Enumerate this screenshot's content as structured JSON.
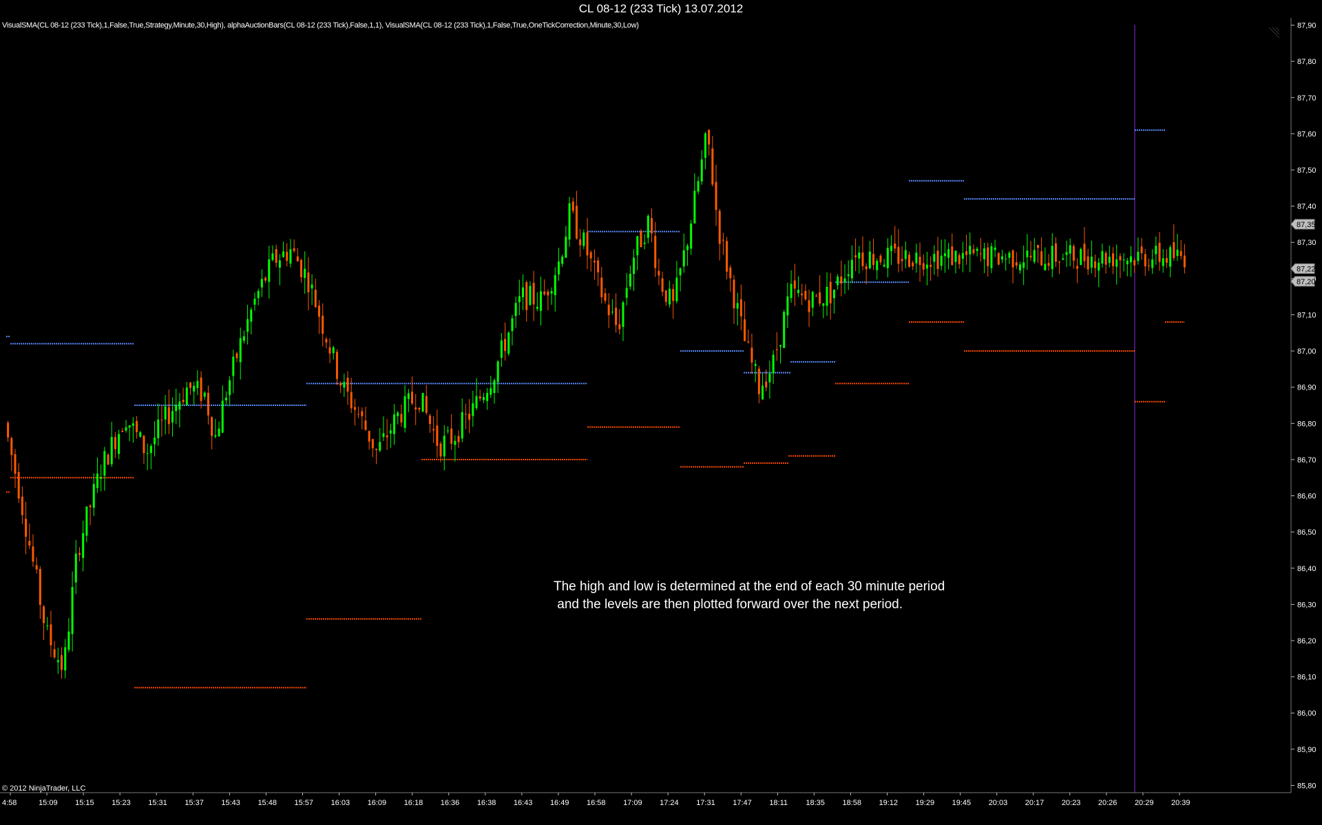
{
  "window": {
    "title": "CL 08-12 (233 Tick)  13.07.2012"
  },
  "indicator_legend": "VisualSMA(CL 08-12 (233 Tick),1,False,True,Strategy,Minute,30,High), alphaAuctionBars(CL 08-12 (233 Tick),False,1,1), VisualSMA(CL 08-12 (233 Tick),1,False,True,OneTickCorrection,Minute,30,Low)",
  "annotation": "The high and low is determined at the end of each 30 minute period\n and the levels are then plotted forward over the next period.",
  "copyright": "© 2012 NinjaTrader, LLC",
  "colors": {
    "up": "#00ff00",
    "down": "#ff5a00",
    "high_level": "#5a8cff",
    "low_level": "#ff4a00",
    "grid_border": "#7a7a7a",
    "session_line": "#8a2be2"
  },
  "chart_data": {
    "type": "candlestick",
    "ylim": [
      85.78,
      87.92
    ],
    "y_ticks": [
      "87,90",
      "87,80",
      "87,70",
      "87,60",
      "87,50",
      "87,40",
      "87,30",
      "87,20",
      "87,10",
      "87,00",
      "86,90",
      "86,80",
      "86,70",
      "86,60",
      "86,50",
      "86,40",
      "86,30",
      "86,20",
      "86,10",
      "86,00",
      "85,90",
      "85,80"
    ],
    "y_tick_values": [
      87.9,
      87.8,
      87.7,
      87.6,
      87.5,
      87.4,
      87.3,
      87.2,
      87.1,
      87.0,
      86.9,
      86.8,
      86.7,
      86.6,
      86.5,
      86.4,
      86.3,
      86.2,
      86.1,
      86.0,
      85.9,
      85.8
    ],
    "x_ticks": [
      "4:58",
      "15:09",
      "15:15",
      "15:23",
      "15:31",
      "15:37",
      "15:43",
      "15:48",
      "15:57",
      "16:03",
      "16:09",
      "16:18",
      "16:36",
      "16:38",
      "16:43",
      "16:49",
      "16:58",
      "17:09",
      "17:24",
      "17:31",
      "17:47",
      "18:11",
      "18:35",
      "18:58",
      "19:12",
      "19:29",
      "19:45",
      "20:03",
      "20:17",
      "20:23",
      "20:26",
      "20:29",
      "20:39"
    ],
    "price_badges": [
      "87,35",
      "87,22",
      "87,20"
    ],
    "price_badge_values": [
      87.35,
      87.22,
      87.2
    ],
    "bars": 330,
    "price_path": [
      [
        0,
        86.88
      ],
      [
        30,
        86.62
      ],
      [
        70,
        86.22
      ],
      [
        95,
        86.12
      ],
      [
        115,
        86.45
      ],
      [
        150,
        86.68
      ],
      [
        185,
        86.82
      ],
      [
        215,
        86.72
      ],
      [
        245,
        86.82
      ],
      [
        275,
        86.9
      ],
      [
        300,
        86.88
      ],
      [
        315,
        86.76
      ],
      [
        330,
        86.88
      ],
      [
        355,
        87.04
      ],
      [
        375,
        87.15
      ],
      [
        400,
        87.25
      ],
      [
        425,
        87.28
      ],
      [
        450,
        87.2
      ],
      [
        475,
        87.05
      ],
      [
        500,
        86.9
      ],
      [
        525,
        86.82
      ],
      [
        550,
        86.72
      ],
      [
        580,
        86.82
      ],
      [
        610,
        86.88
      ],
      [
        640,
        86.74
      ],
      [
        660,
        86.76
      ],
      [
        690,
        86.84
      ],
      [
        720,
        86.94
      ],
      [
        760,
        87.15
      ],
      [
        790,
        87.14
      ],
      [
        815,
        87.25
      ],
      [
        830,
        87.38
      ],
      [
        850,
        87.3
      ],
      [
        880,
        87.14
      ],
      [
        900,
        87.06
      ],
      [
        920,
        87.25
      ],
      [
        945,
        87.36
      ],
      [
        960,
        87.2
      ],
      [
        980,
        87.12
      ],
      [
        1000,
        87.3
      ],
      [
        1015,
        87.45
      ],
      [
        1030,
        87.6
      ],
      [
        1045,
        87.35
      ],
      [
        1065,
        87.18
      ],
      [
        1085,
        87.02
      ],
      [
        1105,
        86.9
      ],
      [
        1125,
        86.96
      ],
      [
        1150,
        87.16
      ],
      [
        1180,
        87.14
      ],
      [
        1210,
        87.16
      ],
      [
        1230,
        87.22
      ],
      [
        1245,
        87.28
      ],
      [
        1255,
        87.26
      ]
    ],
    "high_levels": [
      {
        "x0": 9,
        "x1": 15,
        "y": 87.04
      },
      {
        "x0": 15,
        "x1": 195,
        "y": 87.02
      },
      {
        "x0": 195,
        "x1": 445,
        "y": 86.85
      },
      {
        "x0": 445,
        "x1": 853,
        "y": 86.91
      },
      {
        "x0": 853,
        "x1": 988,
        "y": 87.33
      },
      {
        "x0": 988,
        "x1": 1080,
        "y": 87.0
      },
      {
        "x0": 1080,
        "x1": 1148,
        "y": 86.94
      },
      {
        "x0": 1148,
        "x1": 1213,
        "y": 86.97
      },
      {
        "x0": 1213,
        "x1": 1320,
        "y": 87.19
      },
      {
        "x0": 1320,
        "x1": 1400,
        "y": 87.47
      },
      {
        "x0": 1400,
        "x1": 1648,
        "y": 87.42
      },
      {
        "x0": 1648,
        "x1": 1692,
        "y": 87.61
      }
    ],
    "low_levels": [
      {
        "x0": 9,
        "x1": 15,
        "y": 86.61
      },
      {
        "x0": 15,
        "x1": 195,
        "y": 86.65
      },
      {
        "x0": 195,
        "x1": 445,
        "y": 86.07
      },
      {
        "x0": 445,
        "x1": 612,
        "y": 86.26
      },
      {
        "x0": 612,
        "x1": 853,
        "y": 86.7
      },
      {
        "x0": 853,
        "x1": 988,
        "y": 86.79
      },
      {
        "x0": 988,
        "x1": 1080,
        "y": 86.68
      },
      {
        "x0": 1080,
        "x1": 1145,
        "y": 86.69
      },
      {
        "x0": 1145,
        "x1": 1213,
        "y": 86.71
      },
      {
        "x0": 1213,
        "x1": 1320,
        "y": 86.91
      },
      {
        "x0": 1320,
        "x1": 1400,
        "y": 87.08
      },
      {
        "x0": 1400,
        "x1": 1648,
        "y": 87.0
      },
      {
        "x0": 1648,
        "x1": 1692,
        "y": 86.86
      },
      {
        "x0": 1692,
        "x1": 1720,
        "y": 87.08
      }
    ]
  }
}
